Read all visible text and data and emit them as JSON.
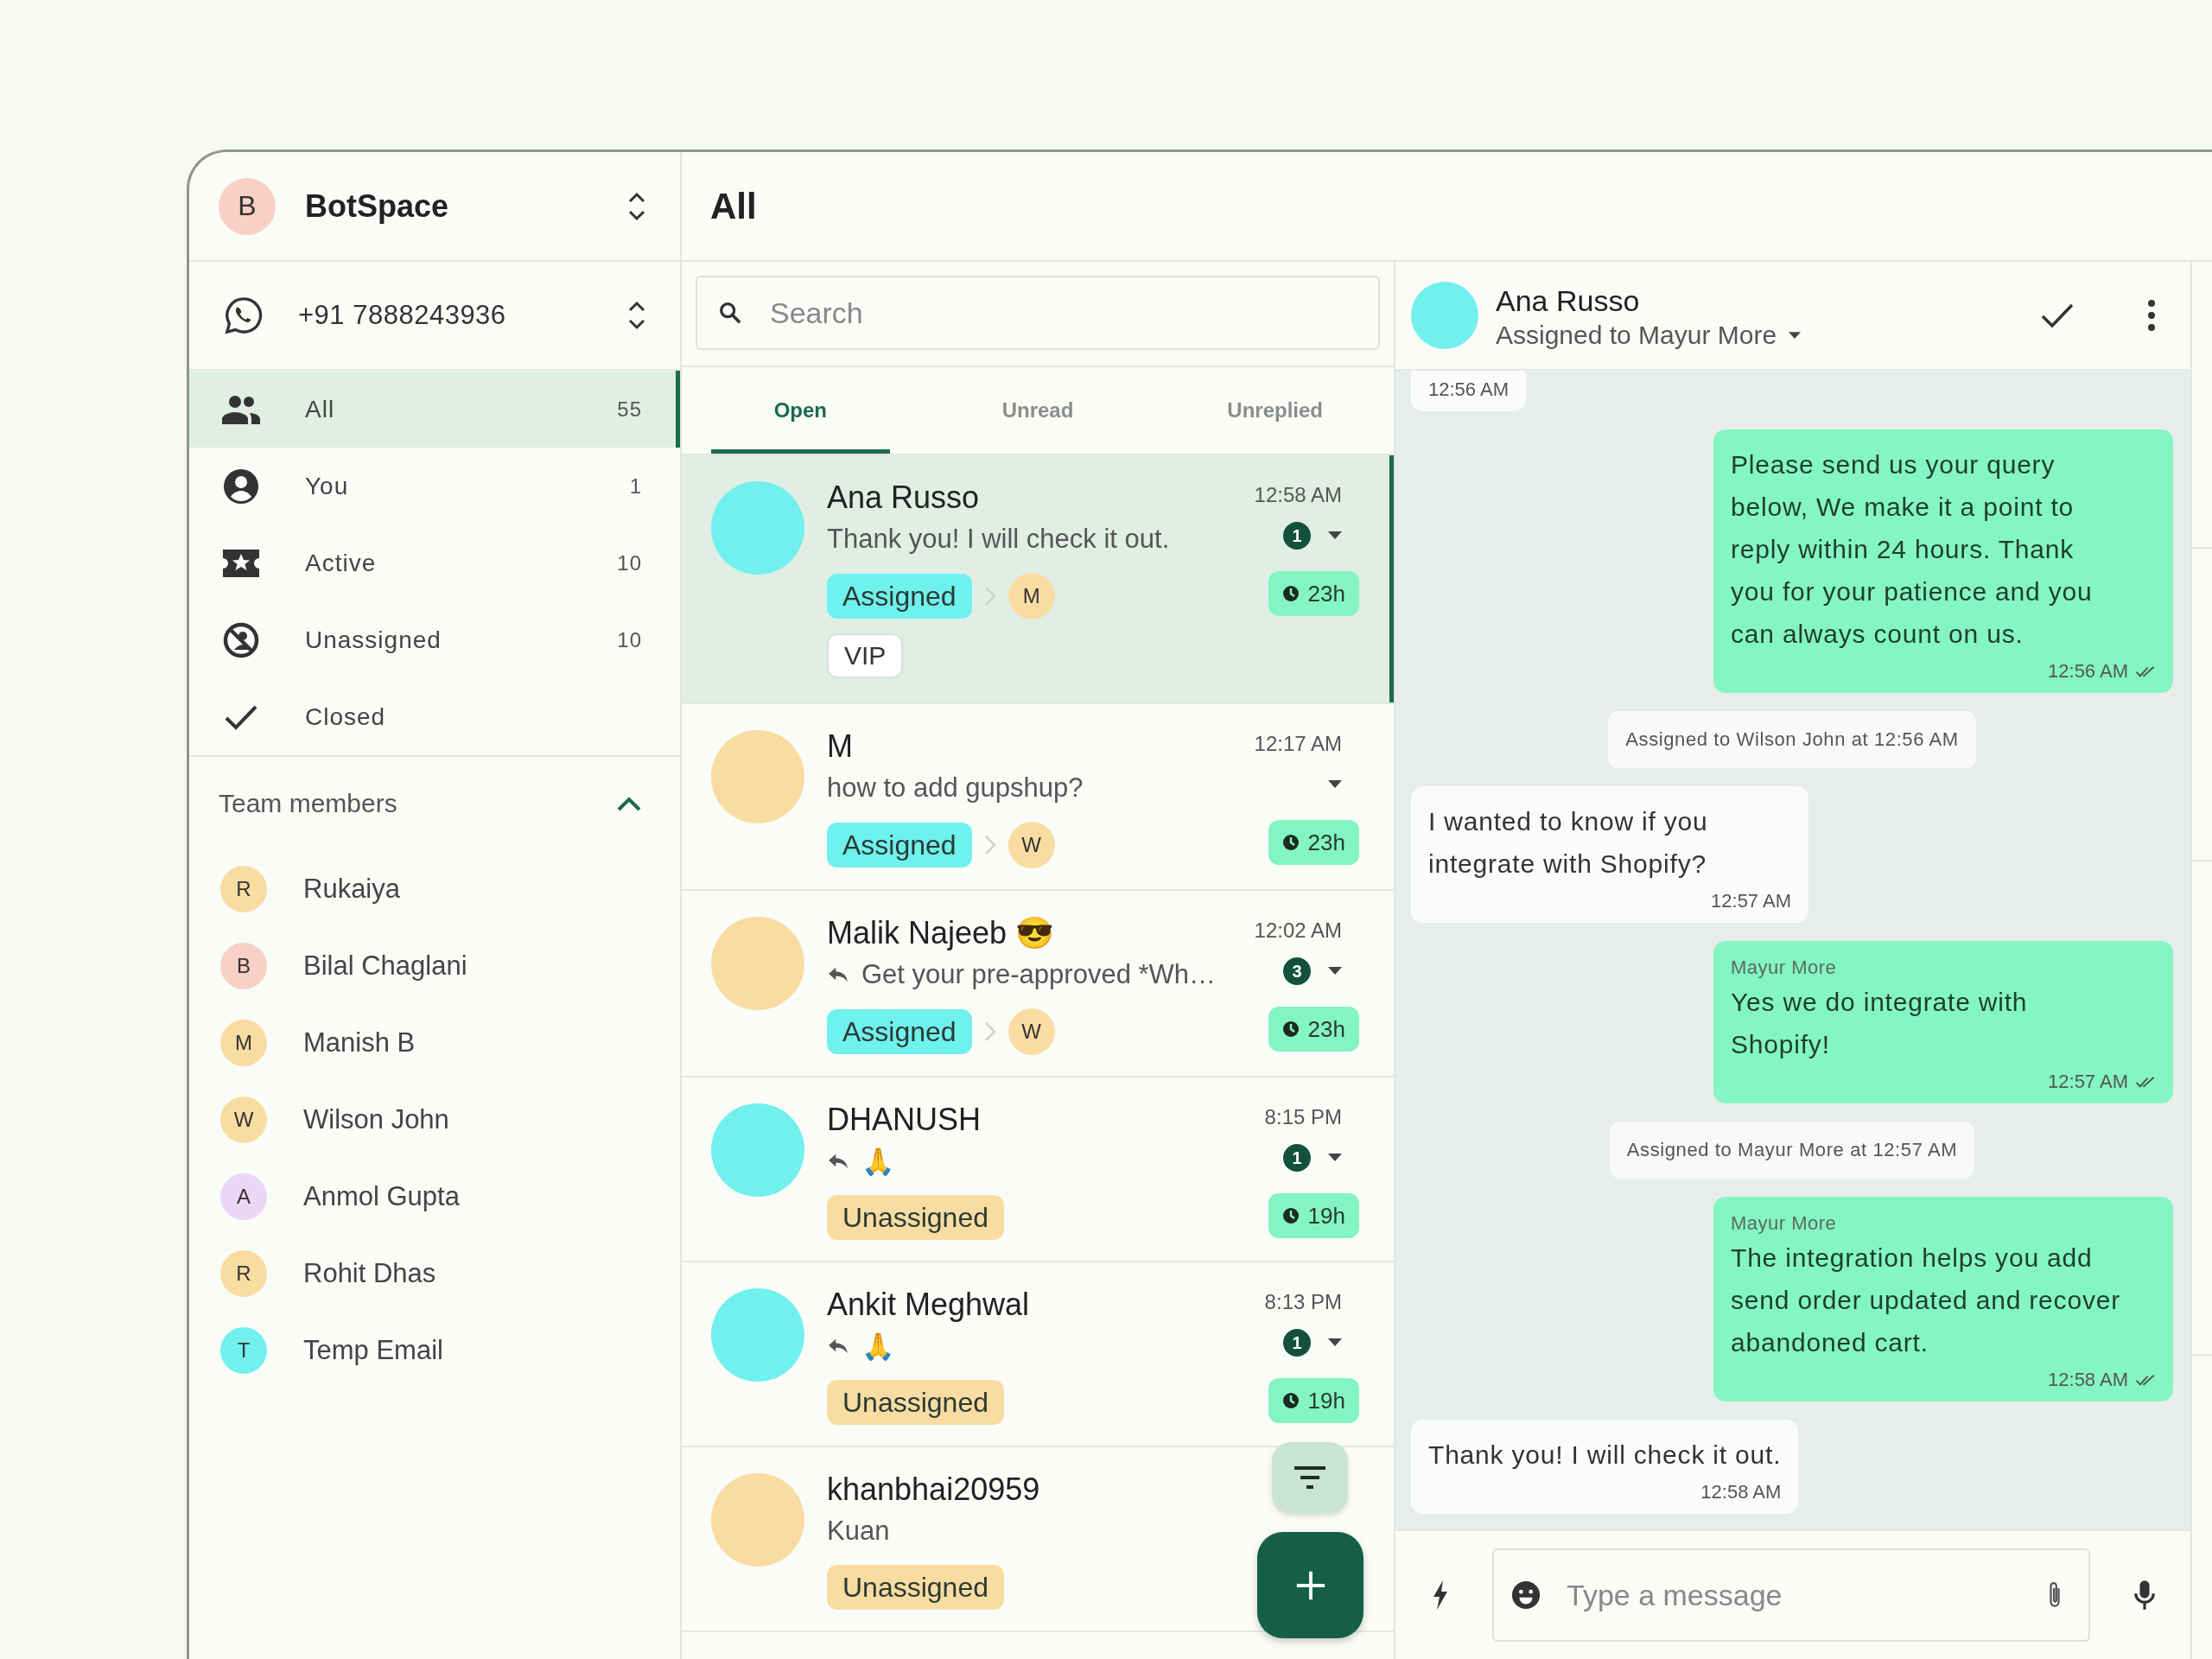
{
  "workspace": {
    "initial": "B",
    "name": "BotSpace",
    "color": "#f8d0c6"
  },
  "phone": {
    "number": "+91 7888243936"
  },
  "nav": [
    {
      "label": "All",
      "count": "55",
      "selected": true
    },
    {
      "label": "You",
      "count": "1",
      "selected": false
    },
    {
      "label": "Active",
      "count": "10",
      "selected": false
    },
    {
      "label": "Unassigned",
      "count": "10",
      "selected": false
    },
    {
      "label": "Closed",
      "selected": false
    }
  ],
  "team": {
    "title": "Team members",
    "expanded": true,
    "members": [
      {
        "initial": "R",
        "name": "Rukaiya",
        "color": "#f9dca2"
      },
      {
        "initial": "B",
        "name": "Bilal Chaglani",
        "color": "#f8d0c6"
      },
      {
        "initial": "M",
        "name": "Manish B",
        "color": "#f9dca2"
      },
      {
        "initial": "W",
        "name": "Wilson John",
        "color": "#f9dca2"
      },
      {
        "initial": "A",
        "name": "Anmol Gupta",
        "color": "#ecd6f6"
      },
      {
        "initial": "R",
        "name": "Rohit Dhas",
        "color": "#f9dca2"
      },
      {
        "initial": "T",
        "name": "Temp Email",
        "color": "#72f0ee"
      }
    ]
  },
  "list": {
    "title": "All",
    "search": {
      "placeholder": "Search"
    },
    "tabs": [
      {
        "label": "Open",
        "selected": true
      },
      {
        "label": "Unread",
        "selected": false
      },
      {
        "label": "Unreplied",
        "selected": false
      }
    ],
    "conversations": [
      {
        "name": "Ana Russo",
        "color": "#72f0ee",
        "replied": false,
        "preview": "Thank you! I will check it out.",
        "time": "12:58 AM",
        "unread": "1",
        "status": {
          "kind": "assigned",
          "label": "Assigned"
        },
        "assignee": {
          "initial": "M",
          "color": "#f9dca2"
        },
        "timer": "23h",
        "tags": [
          "VIP"
        ],
        "selected": true
      },
      {
        "name": "M",
        "color": "#f9dca2",
        "replied": false,
        "preview": "how to add gupshup?",
        "time": "12:17 AM",
        "status": {
          "kind": "assigned",
          "label": "Assigned"
        },
        "assignee": {
          "initial": "W",
          "color": "#f9dca2"
        },
        "timer": "23h",
        "selected": false
      },
      {
        "name": "Malik Najeeb 😎",
        "color": "#f9dca2",
        "replied": true,
        "preview": "Get your pre-approved *Wh…",
        "time": "12:02 AM",
        "unread": "3",
        "status": {
          "kind": "assigned",
          "label": "Assigned"
        },
        "assignee": {
          "initial": "W",
          "color": "#f9dca2"
        },
        "timer": "23h",
        "selected": false
      },
      {
        "name": "DHANUSH",
        "color": "#72f0ee",
        "replied": true,
        "preview": "🙏",
        "time": "8:15 PM",
        "unread": "1",
        "status": {
          "kind": "unassigned",
          "label": "Unassigned"
        },
        "timer": "19h",
        "selected": false
      },
      {
        "name": "Ankit Meghwal",
        "color": "#72f0ee",
        "replied": true,
        "preview": "🙏",
        "time": "8:13 PM",
        "unread": "1",
        "status": {
          "kind": "unassigned",
          "label": "Unassigned"
        },
        "timer": "19h",
        "selected": false
      },
      {
        "name": "khanbhai20959",
        "color": "#f9dca2",
        "replied": false,
        "preview": "Kuan",
        "status": {
          "kind": "unassigned",
          "label": "Unassigned"
        },
        "selected": false
      }
    ]
  },
  "chat": {
    "contact": {
      "name": "Ana Russo",
      "color": "#72f0ee",
      "assigned": "Assigned to Mayur More"
    },
    "messages": [
      {
        "kind": "incoming",
        "time": "12:56 AM"
      },
      {
        "kind": "outgoing",
        "text": "Please send us your query below, We make it a point to reply within 24 hours. Thank you for your patience and you can always count on us.",
        "time": "12:56 AM",
        "read": true
      },
      {
        "kind": "system",
        "text": "Assigned to Wilson John at 12:56 AM"
      },
      {
        "kind": "incoming",
        "text": "I wanted to know if you integrate with Shopify?",
        "time": "12:57 AM"
      },
      {
        "kind": "outgoing",
        "sender": "Mayur More",
        "text": "Yes we do integrate with Shopify!",
        "time": "12:57 AM",
        "read": true
      },
      {
        "kind": "system",
        "text": "Assigned to Mayur More at 12:57 AM"
      },
      {
        "kind": "outgoing",
        "sender": "Mayur More",
        "text": "The integration helps you add send order updated and recover abandoned cart.",
        "time": "12:58 AM",
        "read": true
      },
      {
        "kind": "incoming",
        "text": "Thank you! I will check it out.",
        "time": "12:58 AM"
      }
    ],
    "composer": {
      "placeholder": "Type a message"
    }
  }
}
